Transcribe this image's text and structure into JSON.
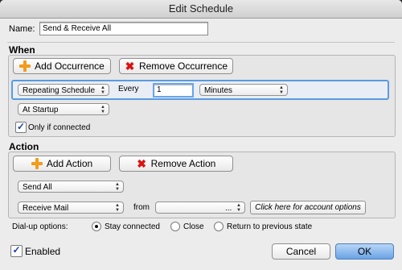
{
  "window": {
    "title": "Edit Schedule"
  },
  "name_field": {
    "label": "Name:",
    "value": "Send & Receive All"
  },
  "when": {
    "heading": "When",
    "add_occurrence_label": "Add Occurrence",
    "remove_occurrence_label": "Remove Occurrence",
    "schedule_type": "Repeating Schedule",
    "every_label": "Every",
    "interval_value": "1",
    "interval_unit": "Minutes",
    "trigger": "At Startup",
    "only_if_connected_label": "Only if connected",
    "only_if_connected_checked": true
  },
  "action": {
    "heading": "Action",
    "add_action_label": "Add Action",
    "remove_action_label": "Remove Action",
    "action_one": "Send All",
    "action_two": "Receive Mail",
    "from_label": "from",
    "account_popup_value": "...",
    "account_options_button": "Click here for account options"
  },
  "dialup": {
    "label": "Dial-up options:",
    "options": [
      "Stay connected",
      "Close",
      "Return to previous state"
    ],
    "selected_index": 0
  },
  "footer": {
    "enabled_label": "Enabled",
    "enabled_checked": true,
    "cancel_label": "Cancel",
    "ok_label": "OK"
  },
  "colors": {
    "accent_blue": "#5b9ae0",
    "ok_blue": "#7fb3ee",
    "icon_orange": "#f39b1b",
    "icon_red": "#dd1111"
  },
  "icons": [
    "add-icon",
    "remove-icon",
    "checkmark-icon"
  ]
}
